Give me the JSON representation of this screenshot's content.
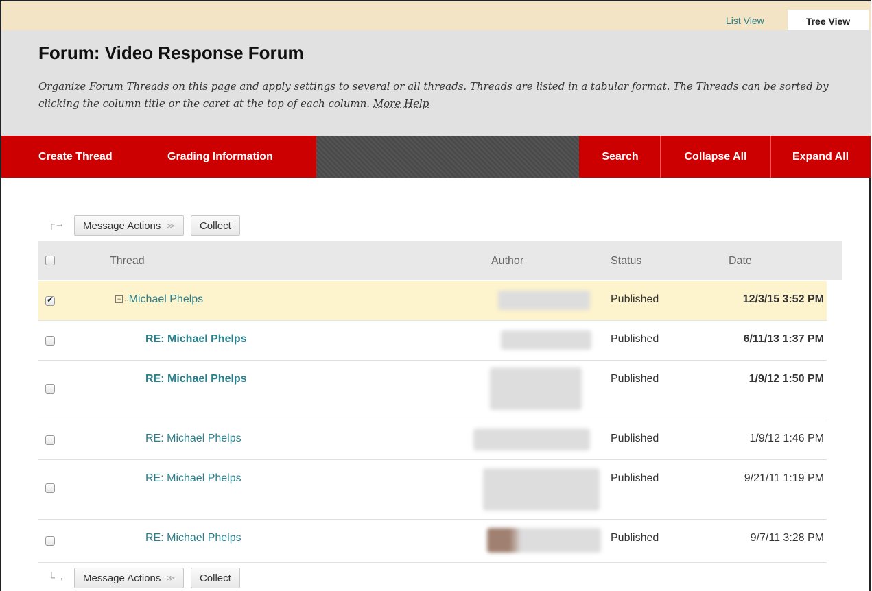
{
  "view_tabs": {
    "list": "List View",
    "tree": "Tree View"
  },
  "header": {
    "title": "Forum: Video Response Forum",
    "description": "Organize Forum Threads on this page and apply settings to several or all threads. Threads are listed in a tabular format. The Threads can be sorted by clicking the column title or the caret at the top of each column. ",
    "more_help": "More Help"
  },
  "action_bar": {
    "create_thread": "Create Thread",
    "grading_information": "Grading Information",
    "search": "Search",
    "collapse_all": "Collapse All",
    "expand_all": "Expand All"
  },
  "toolbar": {
    "message_actions": "Message Actions",
    "collect": "Collect"
  },
  "columns": {
    "thread": "Thread",
    "author": "Author",
    "status": "Status",
    "date": "Date"
  },
  "rows": [
    {
      "thread": "Michael Phelps",
      "status": "Published",
      "date": "12/3/15 3:52 PM",
      "checked": true,
      "unread": false,
      "root": true
    },
    {
      "thread": "RE: Michael Phelps",
      "status": "Published",
      "date": "6/11/13 1:37 PM",
      "checked": false,
      "unread": true
    },
    {
      "thread": "RE: Michael Phelps",
      "status": "Published",
      "date": "1/9/12 1:50 PM",
      "checked": false,
      "unread": true
    },
    {
      "thread": "RE: Michael Phelps",
      "status": "Published",
      "date": "1/9/12 1:46 PM",
      "checked": false,
      "unread": false
    },
    {
      "thread": "RE: Michael Phelps",
      "status": "Published",
      "date": "9/21/11 1:19 PM",
      "checked": false,
      "unread": false
    },
    {
      "thread": "RE: Michael Phelps",
      "status": "Published",
      "date": "9/7/11 3:28 PM",
      "checked": false,
      "unread": false
    }
  ],
  "colors": {
    "action_bar": "#cc0000",
    "link": "#2a7f8a",
    "header_bg": "#e1e1e1",
    "top_strip": "#f2e4c4",
    "selected_row": "#fdf3cd"
  }
}
